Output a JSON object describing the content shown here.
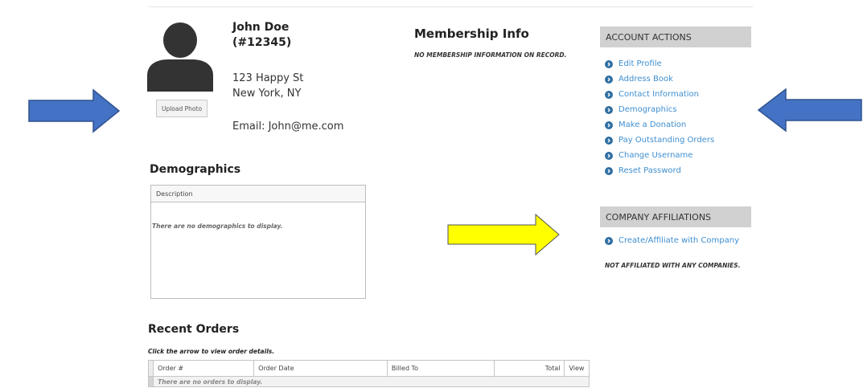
{
  "profile": {
    "name": "John Doe (#12345)",
    "address_line1": "123 Happy St",
    "address_line2": "New York, NY",
    "email": "Email: John@me.com",
    "upload_label": "Upload Photo"
  },
  "membership": {
    "title": "Membership Info",
    "note": "NO MEMBERSHIP INFORMATION ON RECORD."
  },
  "account_actions": {
    "header": "ACCOUNT ACTIONS",
    "items": [
      "Edit Profile",
      "Address Book",
      "Contact Information",
      "Demographics",
      "Make a Donation",
      "Pay Outstanding Orders",
      "Change Username",
      "Reset Password"
    ]
  },
  "company": {
    "header": "COMPANY AFFILIATIONS",
    "link": "Create/Affiliate with Company",
    "note": "NOT AFFILIATED WITH ANY COMPANIES."
  },
  "demographics": {
    "title": "Demographics",
    "column": "Description",
    "empty": "There are no demographics to display."
  },
  "orders": {
    "title": "Recent Orders",
    "note": "Click the arrow to view order details.",
    "columns": [
      "Order #",
      "Order Date",
      "Billed To",
      "Total",
      "View"
    ],
    "empty": "There are no orders to display."
  },
  "colors": {
    "link": "#3f8fd0",
    "sidebar_header_bg": "#d1d1d1",
    "blue_arrow": "#4472c4",
    "yellow_arrow": "#ffff00"
  }
}
